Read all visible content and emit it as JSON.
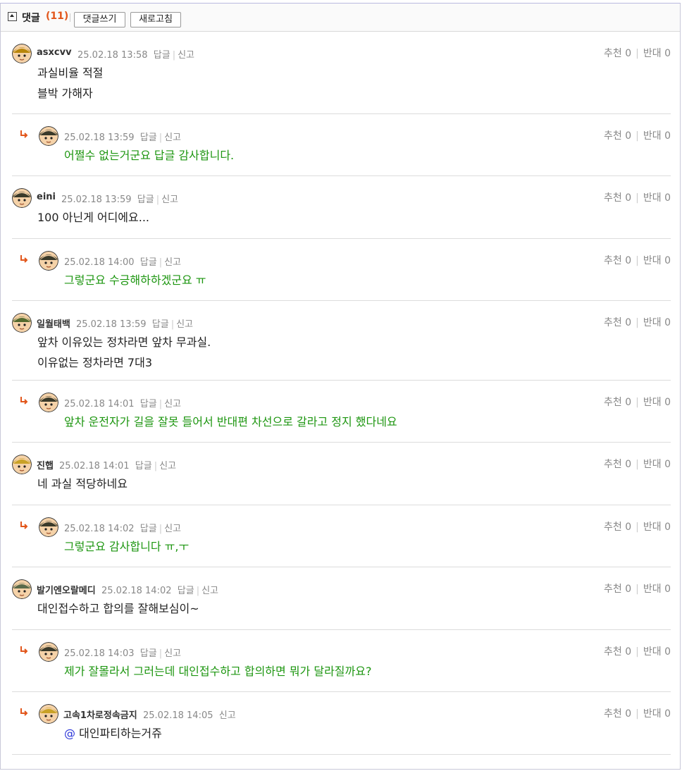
{
  "header": {
    "title": "댓글",
    "count": "(11)",
    "write_button": "댓글쓰기",
    "refresh_button": "새로고침"
  },
  "labels": {
    "reply": "답글",
    "report": "신고",
    "upvote": "추천",
    "downvote": "반대"
  },
  "comments": [
    {
      "nick": "asxcvv",
      "date": "25.02.18 13:58",
      "lines": [
        "과실비율 적절",
        "블박 가해자"
      ],
      "up": "0",
      "down": "0",
      "reply": false
    },
    {
      "nick": "",
      "date": "25.02.18 13:59",
      "lines": [
        "어쩔수 없는거군요 답글 감사합니다."
      ],
      "up": "0",
      "down": "0",
      "reply": true
    },
    {
      "nick": "eini",
      "date": "25.02.18 13:59",
      "lines": [
        "100 아닌게 어디에요..."
      ],
      "up": "0",
      "down": "0",
      "reply": false
    },
    {
      "nick": "",
      "date": "25.02.18 14:00",
      "lines": [
        "그렇군요 수긍해하하겠군요 ㅠ"
      ],
      "up": "0",
      "down": "0",
      "reply": true
    },
    {
      "nick": "일월태백",
      "date": "25.02.18 13:59",
      "lines": [
        "앞차 이유있는 정차라면 앞차 무과실.",
        "이유없는 정차라면 7대3"
      ],
      "up": "0",
      "down": "0",
      "reply": false
    },
    {
      "nick": "",
      "date": "25.02.18 14:01",
      "lines": [
        "앞차 운전자가 길을 잘못 들어서 반대편 차선으로 갈라고 정지 했다네요"
      ],
      "up": "0",
      "down": "0",
      "reply": true
    },
    {
      "nick": "진햅",
      "date": "25.02.18 14:01",
      "lines": [
        "네 과실 적당하네요"
      ],
      "up": "0",
      "down": "0",
      "reply": false
    },
    {
      "nick": "",
      "date": "25.02.18 14:02",
      "lines": [
        "그렇군요 감사합니다 ㅠ,ㅜ"
      ],
      "up": "0",
      "down": "0",
      "reply": true
    },
    {
      "nick": "발기엔오랄메디",
      "date": "25.02.18 14:02",
      "lines": [
        "대인접수하고 합의를 잘해보심이~"
      ],
      "up": "0",
      "down": "0",
      "reply": false
    },
    {
      "nick": "",
      "date": "25.02.18 14:03",
      "lines": [
        "제가 잘몰라서 그러는데 대인접수하고 합의하면 뭐가 달라질까요?"
      ],
      "up": "0",
      "down": "0",
      "reply": true
    },
    {
      "nick": "고속1차로정속금지",
      "date": "25.02.18 14:05",
      "mention": "@",
      "lines": [
        "대인파티하는거쥬"
      ],
      "up": "0",
      "down": "0",
      "reply": true
    }
  ],
  "colors": {
    "reply_text": "#1d9610",
    "count": "#e2561b",
    "mention": "#2c36d8",
    "reply_arrow": "#e2561b"
  }
}
